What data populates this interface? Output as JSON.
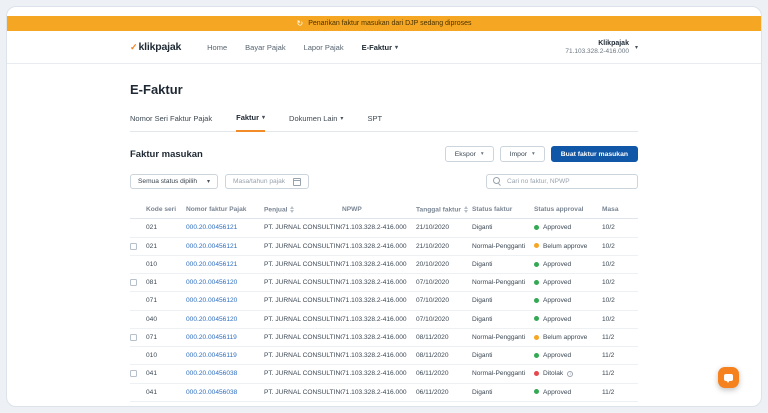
{
  "icons": {
    "caret": "▾",
    "check": "✓",
    "refresh": "↻",
    "info": "i"
  },
  "colors": {
    "banner_bg": "#F5A623",
    "primary_button": "#1157A8",
    "link": "#2E6FC1",
    "status_green": "#34A853",
    "status_yellow": "#F5A623",
    "status_red": "#E5484D",
    "tab_accent": "#F28C28",
    "chat_button": "#F5821F"
  },
  "banner": {
    "text": "Penarikan faktur masukan dari DJP sedang diproses"
  },
  "header": {
    "logo": "klikpajak",
    "nav": [
      {
        "label": "Home"
      },
      {
        "label": "Bayar Pajak"
      },
      {
        "label": "Lapor Pajak"
      },
      {
        "label": "E-Faktur"
      }
    ],
    "account": {
      "name": "Klikpajak",
      "npwp": "71.103.328.2-416.000"
    }
  },
  "page": {
    "title": "E-Faktur",
    "tabs": [
      {
        "label": "Nomor Seri Faktur Pajak"
      },
      {
        "label": "Faktur"
      },
      {
        "label": "Dokumen Lain"
      },
      {
        "label": "SPT"
      }
    ],
    "section_title": "Faktur masukan",
    "actions": {
      "ekspor": "Ekspor",
      "impor": "Impor",
      "create": "Buat faktur masukan"
    },
    "filters": {
      "status": "Semua status dipilih",
      "masa": "Masa/tahun pajak",
      "search_placeholder": "Cari no faktur, NPWP"
    }
  },
  "table": {
    "columns": [
      "Kode seri",
      "Nomor faktur Pajak",
      "Penjual",
      "NPWP",
      "Tanggal faktur",
      "Status faktur",
      "Status approval",
      "Masa"
    ],
    "rows": [
      {
        "checkbox": false,
        "kode": "021",
        "nomor": "000.20.00456121",
        "penjual": "PT. JURNAL CONSULTING",
        "npwp": "71.103.328.2-416.000",
        "tanggal": "21/10/2020",
        "status_faktur": "Diganti",
        "status_approval": "Approved",
        "approval_color": "green",
        "info": false,
        "masa": "10/2"
      },
      {
        "checkbox": true,
        "kode": "021",
        "nomor": "000.20.00456121",
        "penjual": "PT. JURNAL CONSULTING",
        "npwp": "71.103.328.2-416.000",
        "tanggal": "21/10/2020",
        "status_faktur": "Normal-Pengganti",
        "status_approval": "Belum approve",
        "approval_color": "yellow",
        "info": false,
        "masa": "10/2"
      },
      {
        "checkbox": false,
        "kode": "010",
        "nomor": "000.20.00456121",
        "penjual": "PT. JURNAL CONSULTING",
        "npwp": "71.103.328.2-416.000",
        "tanggal": "20/10/2020",
        "status_faktur": "Diganti",
        "status_approval": "Approved",
        "approval_color": "green",
        "info": false,
        "masa": "10/2"
      },
      {
        "checkbox": true,
        "kode": "081",
        "nomor": "000.20.00456120",
        "penjual": "PT. JURNAL CONSULTING",
        "npwp": "71.103.328.2-416.000",
        "tanggal": "07/10/2020",
        "status_faktur": "Normal-Pengganti",
        "status_approval": "Approved",
        "approval_color": "green",
        "info": false,
        "masa": "10/2"
      },
      {
        "checkbox": false,
        "kode": "071",
        "nomor": "000.20.00456120",
        "penjual": "PT. JURNAL CONSULTING",
        "npwp": "71.103.328.2-416.000",
        "tanggal": "07/10/2020",
        "status_faktur": "Diganti",
        "status_approval": "Approved",
        "approval_color": "green",
        "info": false,
        "masa": "10/2"
      },
      {
        "checkbox": false,
        "kode": "040",
        "nomor": "000.20.00456120",
        "penjual": "PT. JURNAL CONSULTING",
        "npwp": "71.103.328.2-416.000",
        "tanggal": "07/10/2020",
        "status_faktur": "Diganti",
        "status_approval": "Approved",
        "approval_color": "green",
        "info": false,
        "masa": "10/2"
      },
      {
        "checkbox": true,
        "kode": "071",
        "nomor": "000.20.00456119",
        "penjual": "PT. JURNAL CONSULTING",
        "npwp": "71.103.328.2-416.000",
        "tanggal": "08/11/2020",
        "status_faktur": "Normal-Pengganti",
        "status_approval": "Belum approve",
        "approval_color": "yellow",
        "info": false,
        "masa": "11/2"
      },
      {
        "checkbox": false,
        "kode": "010",
        "nomor": "000.20.00456119",
        "penjual": "PT. JURNAL CONSULTING",
        "npwp": "71.103.328.2-416.000",
        "tanggal": "08/11/2020",
        "status_faktur": "Diganti",
        "status_approval": "Approved",
        "approval_color": "green",
        "info": false,
        "masa": "11/2"
      },
      {
        "checkbox": true,
        "kode": "041",
        "nomor": "000.20.00456038",
        "penjual": "PT. JURNAL CONSULTING",
        "npwp": "71.103.328.2-416.000",
        "tanggal": "06/11/2020",
        "status_faktur": "Normal-Pengganti",
        "status_approval": "Ditolak",
        "approval_color": "red",
        "info": true,
        "masa": "11/2"
      },
      {
        "checkbox": false,
        "kode": "041",
        "nomor": "000.20.00456038",
        "penjual": "PT. JURNAL CONSULTING",
        "npwp": "71.103.328.2-416.000",
        "tanggal": "06/11/2020",
        "status_faktur": "Diganti",
        "status_approval": "Approved",
        "approval_color": "green",
        "info": false,
        "masa": "11/2"
      }
    ]
  }
}
